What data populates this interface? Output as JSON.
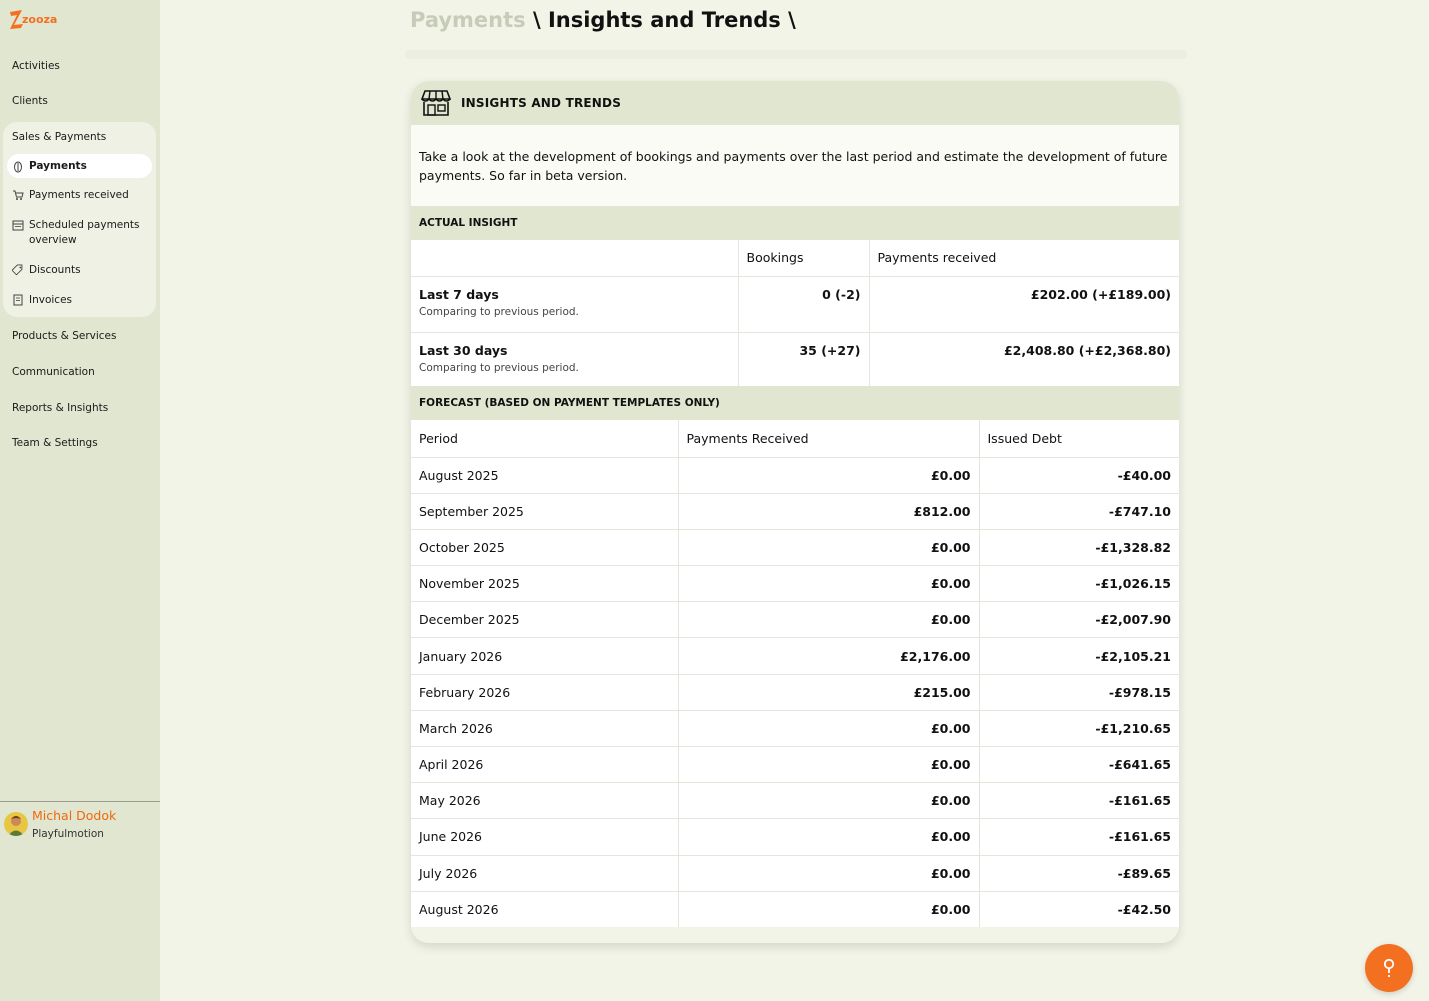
{
  "brand": {
    "logo_text": "zooza",
    "accent": "#f37021"
  },
  "sidebar": {
    "items": [
      {
        "label": "Activities"
      },
      {
        "label": "Clients"
      },
      {
        "label": "Sales & Payments"
      },
      {
        "label": "Products & Services"
      },
      {
        "label": "Communication"
      },
      {
        "label": "Reports & Insights"
      },
      {
        "label": "Team & Settings"
      }
    ],
    "sub_items": [
      {
        "label": "Payments",
        "icon": "coin-icon",
        "active": true
      },
      {
        "label": "Payments received",
        "icon": "cart-icon"
      },
      {
        "label": "Scheduled payments overview",
        "icon": "calendar-icon"
      },
      {
        "label": "Discounts",
        "icon": "tag-icon"
      },
      {
        "label": "Invoices",
        "icon": "invoice-icon"
      }
    ],
    "user": {
      "name": "Michal Dodok",
      "org": "Playfulmotion"
    }
  },
  "header": {
    "breadcrumb_prev": "Payments",
    "sep1": " \\ ",
    "breadcrumb_current": "Insights and Trends",
    "sep2": " \\"
  },
  "card": {
    "title": "INSIGHTS AND TRENDS",
    "intro": "Take a look at the development of bookings and payments over the last period and estimate the development of future payments. So far in beta version.",
    "actual": {
      "heading": "ACTUAL INSIGHT",
      "columns": [
        "",
        "Bookings",
        "Payments received"
      ],
      "rows": [
        {
          "label": "Last 7 days",
          "sub": "Comparing to previous period.",
          "bookings": "0 (-2)",
          "payments": "£202.00 (+£189.00)"
        },
        {
          "label": "Last 30 days",
          "sub": "Comparing to previous period.",
          "bookings": "35 (+27)",
          "payments": "£2,408.80 (+£2,368.80)"
        }
      ]
    },
    "forecast": {
      "heading": "FORECAST (BASED ON PAYMENT TEMPLATES ONLY)",
      "columns": [
        "Period",
        "Payments Received",
        "Issued Debt"
      ],
      "rows": [
        {
          "period": "August 2025",
          "received": "£0.00",
          "debt": "-£40.00"
        },
        {
          "period": "September 2025",
          "received": "£812.00",
          "debt": "-£747.10"
        },
        {
          "period": "October 2025",
          "received": "£0.00",
          "debt": "-£1,328.82"
        },
        {
          "period": "November 2025",
          "received": "£0.00",
          "debt": "-£1,026.15"
        },
        {
          "period": "December 2025",
          "received": "£0.00",
          "debt": "-£2,007.90"
        },
        {
          "period": "January 2026",
          "received": "£2,176.00",
          "debt": "-£2,105.21"
        },
        {
          "period": "February 2026",
          "received": "£215.00",
          "debt": "-£978.15"
        },
        {
          "period": "March 2026",
          "received": "£0.00",
          "debt": "-£1,210.65"
        },
        {
          "period": "April 2026",
          "received": "£0.00",
          "debt": "-£641.65"
        },
        {
          "period": "May 2026",
          "received": "£0.00",
          "debt": "-£161.65"
        },
        {
          "period": "June 2026",
          "received": "£0.00",
          "debt": "-£161.65"
        },
        {
          "period": "July 2026",
          "received": "£0.00",
          "debt": "-£89.65"
        },
        {
          "period": "August 2026",
          "received": "£0.00",
          "debt": "-£42.50"
        }
      ]
    }
  },
  "help": {
    "icon": "help-icon"
  }
}
